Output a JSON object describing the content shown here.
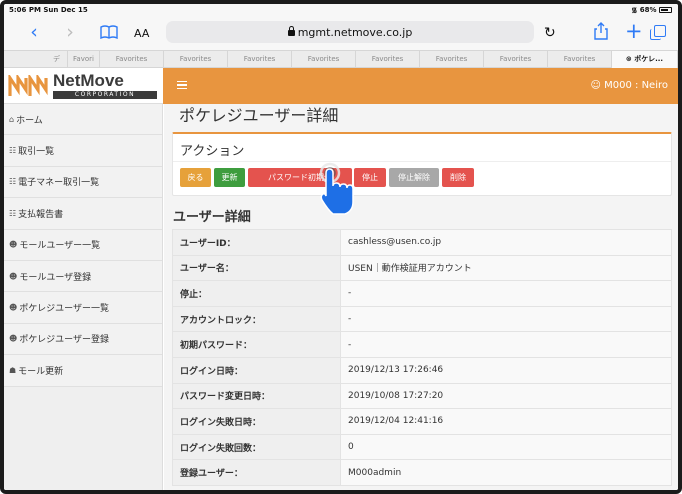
{
  "status_bar": {
    "time": "5:06 PM  Sun Dec 15",
    "battery": "68%"
  },
  "browser": {
    "text_size": "AA",
    "url": "mgmt.netmove.co.jp",
    "favorites": [
      "デ",
      "Favori",
      "Favorites",
      "Favorites",
      "Favorites",
      "Favorites",
      "Favorites",
      "Favorites",
      "Favorites",
      "Favorites"
    ],
    "active_tab": "ポケレ..."
  },
  "header": {
    "logo_text": "NetMove",
    "logo_sub": "CORPORATION",
    "user_label": "M000 : Neiro",
    "accent_color": "#e8953f"
  },
  "sidebar": {
    "items": [
      {
        "icon": "home-icon",
        "label": "ホーム"
      },
      {
        "icon": "document-icon",
        "label": "取引一覧"
      },
      {
        "icon": "document-icon",
        "label": "電子マネー取引一覧"
      },
      {
        "icon": "document-icon",
        "label": "支払報告書"
      },
      {
        "icon": "user-icon",
        "label": "モールユーザー一覧"
      },
      {
        "icon": "user-icon",
        "label": "モールユーザ登録"
      },
      {
        "icon": "users-icon",
        "label": "ポケレジユーザー一覧"
      },
      {
        "icon": "users-icon",
        "label": "ポケレジユーザー登録"
      },
      {
        "icon": "cart-icon",
        "label": "モール更新"
      }
    ]
  },
  "main": {
    "page_title": "ポケレジユーザー詳細",
    "action_title": "アクション",
    "buttons": {
      "back": "戻る",
      "update": "更新",
      "password_reset": "パスワード初期化",
      "stop": "停止",
      "unstop": "停止解除",
      "delete": "削除"
    },
    "section_title": "ユーザー詳細",
    "details": [
      {
        "label": "ユーザーID：",
        "value": "cashless@usen.co.jp"
      },
      {
        "label": "ユーザー名：",
        "value": "USEN｜動作検証用アカウント"
      },
      {
        "label": "停止：",
        "value": "-"
      },
      {
        "label": "アカウントロック：",
        "value": "-"
      },
      {
        "label": "初期パスワード：",
        "value": "-"
      },
      {
        "label": "ログイン日時：",
        "value": "2019/12/13 17:26:46"
      },
      {
        "label": "パスワード変更日時：",
        "value": "2019/10/08 17:27:20"
      },
      {
        "label": "ログイン失敗日時：",
        "value": "2019/12/04 12:41:16"
      },
      {
        "label": "ログイン失敗回数：",
        "value": "0"
      },
      {
        "label": "登録ユーザー：",
        "value": "M000admin"
      }
    ]
  }
}
